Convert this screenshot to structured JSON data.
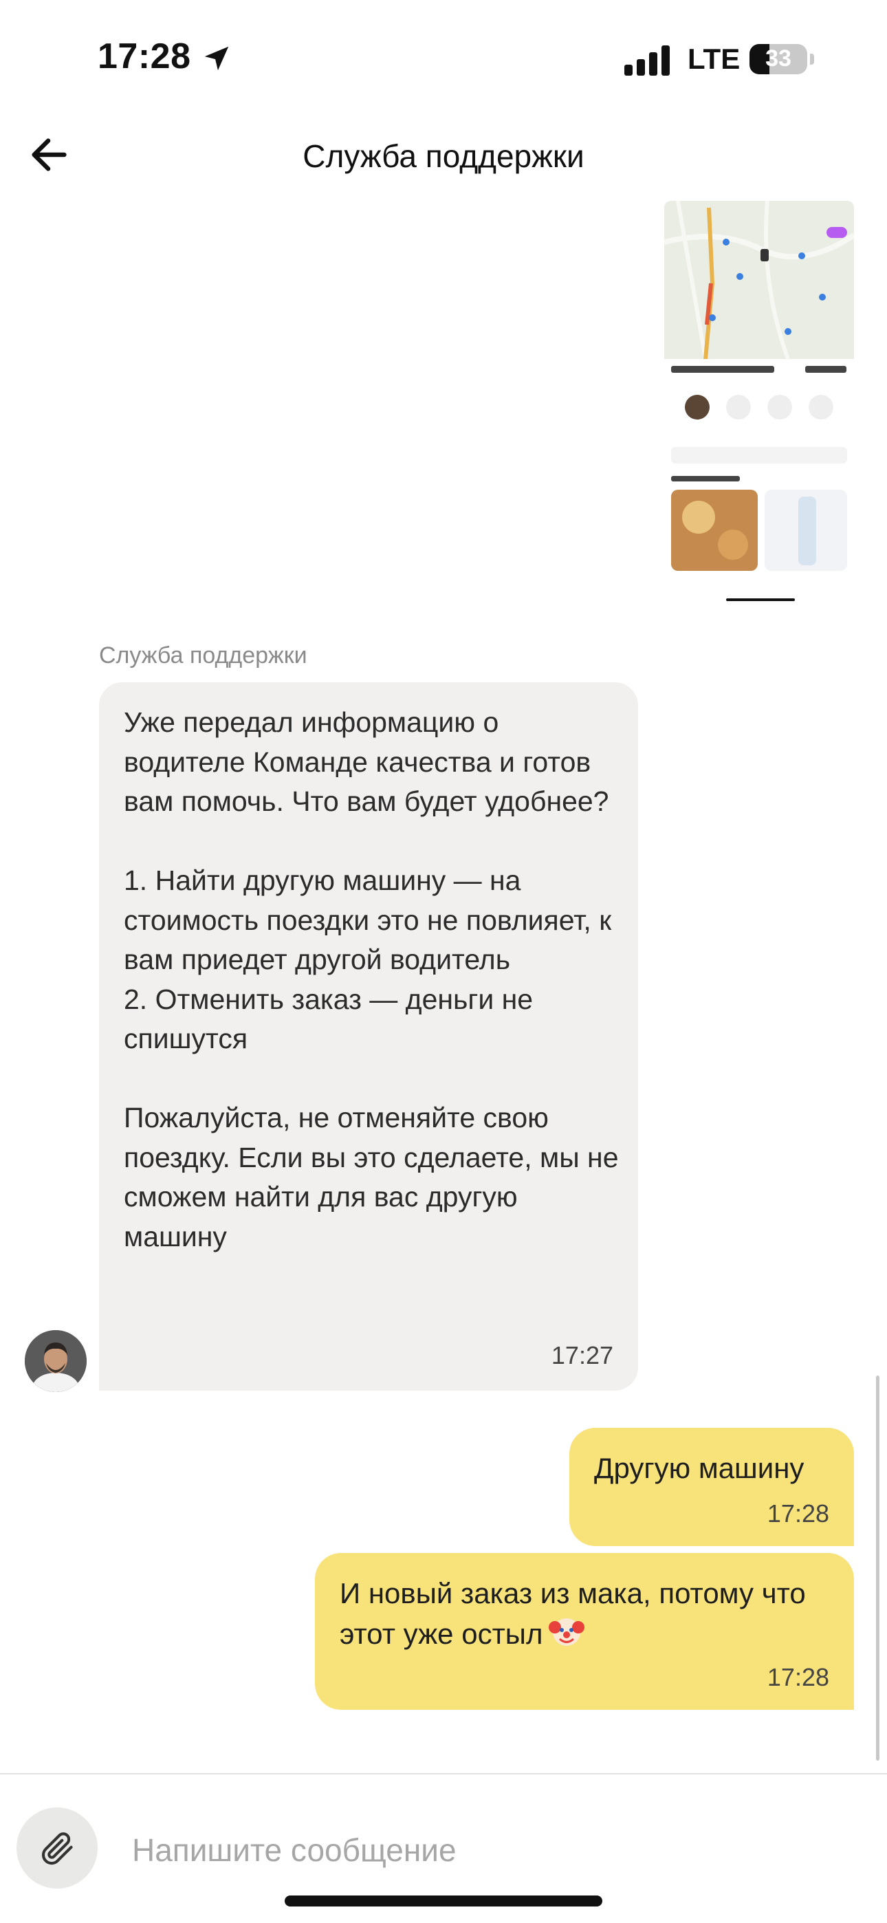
{
  "status_bar": {
    "time": "17:28",
    "network": "LTE",
    "battery": "33",
    "icons": [
      "location-arrow-icon",
      "signal-bars-icon",
      "battery-icon"
    ]
  },
  "header": {
    "title": "Служба поддержки",
    "back_icon": "arrow-left-icon"
  },
  "messages": [
    {
      "from": "support",
      "sender": "Служба поддержки",
      "time": "17:27",
      "text": "Уже передал информацию о водителе Команде качества и готов вам помочь. Что вам будет удобнее?\n\n1. Найти другую машину — на стоимость поездки это не повлияет, к вам приедет другой водитель\n2. Отменить заказ — деньги не спишутся\n\nПожалуйста, не отменяйте свою поездку. Если вы это сделаете, мы не сможем найти для вас другую машину"
    },
    {
      "from": "user",
      "time": "17:28",
      "text": "Другую машину"
    },
    {
      "from": "user",
      "time": "17:28",
      "text": "И новый заказ из мака, потому что этот уже остыл",
      "emoji": "clown-face-emoji"
    }
  ],
  "composer": {
    "placeholder": "Напишите сообщение",
    "attach_icon": "paperclip-icon"
  },
  "colors": {
    "incoming_bubble": "#f1f0ee",
    "outgoing_bubble": "#f8e27a",
    "background": "#ffffff"
  }
}
